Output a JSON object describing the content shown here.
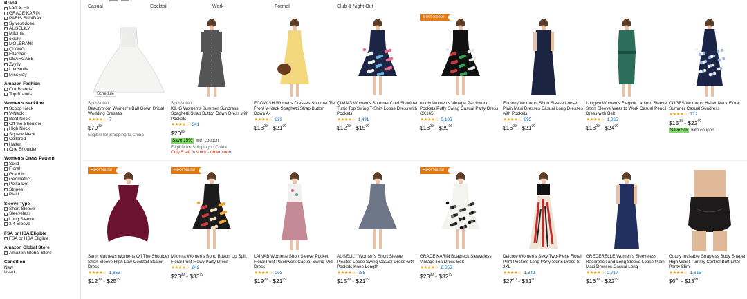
{
  "sidebar": {
    "brand": {
      "title": "Brand",
      "options": [
        "Lark & Ro",
        "GRACE KARIN",
        "PARIS SUNDAY",
        "Sylvestidoso",
        "AUSELILY",
        "Milumia",
        "oxiuly",
        "MOLERANI",
        "QIXING",
        "Ellacher",
        "DEARCASE",
        "Zyyfly",
        "Lotusmile",
        "MissMay"
      ]
    },
    "fashion": {
      "title": "Amazon Fashion",
      "options": [
        "Our Brands",
        "Top Brands"
      ]
    },
    "neckline": {
      "title": "Women's Neckline",
      "options": [
        "Scoop Neck",
        "V-Neck",
        "Boat Neck",
        "Off the Shoulder",
        "High Neck",
        "Square Neck",
        "Collared",
        "Halter",
        "One Shoulder"
      ]
    },
    "pattern": {
      "title": "Women's Dress Pattern",
      "options": [
        "Solid",
        "Floral",
        "Graphic",
        "Geometric",
        "Polka Dot",
        "Stripes",
        "Plaid"
      ]
    },
    "sleeve": {
      "title": "Sleeve Type",
      "options": [
        "Short Sleeve",
        "Sleeveless",
        "Long Sleeve",
        "3/4 Sleeve"
      ]
    },
    "fsa": {
      "title": "FSA or HSA Eligible",
      "options": [
        "FSA or HSA Eligible"
      ]
    },
    "global": {
      "title": "Amazon Global Store",
      "options": [
        "Amazon Global Store"
      ]
    },
    "condition": {
      "title": "Condition",
      "items": [
        "New",
        "Used"
      ]
    }
  },
  "tabs": [
    "Casual",
    "Cocktail",
    "Work",
    "Formal",
    "Club & Night Out"
  ],
  "products": [
    {
      "badge": "",
      "sponsored": "Sponsored",
      "title": "Beautyprom Women's Ball Gown Bridal Wedding Dresses",
      "stars": "★★★★☆",
      "count": "7",
      "price_html": "$79<sup>99</sup>",
      "coupon": "",
      "coupon_label": "",
      "ship": "Eligible for Shipping to China",
      "stock": "",
      "schedule": "Schedule",
      "img": "gown"
    },
    {
      "badge": "",
      "sponsored": "Sponsored",
      "title": "KILIG Women's Summer Sundress Spaghetti Strap Button Down Dress with Pockets",
      "stars": "★★★★☆",
      "count": "341",
      "price_html": "$20<sup>99</sup>",
      "coupon": "Save 15%",
      "coupon_label": "with coupon",
      "ship": "Eligible for Shipping to China",
      "stock": "Only 5 left in stock - order soon.",
      "schedule": "",
      "img": "grey"
    },
    {
      "badge": "",
      "sponsored": "",
      "title": "ECOWISH Womens Dresses Summer Tie Front V-Neck Spaghetti Strap Button Down A-",
      "stars": "★★★★☆",
      "count": "829",
      "price_html": "$18<sup>99</sup> - $21<sup>99</sup>",
      "coupon": "",
      "coupon_label": "",
      "ship": "",
      "stock": "",
      "schedule": "",
      "img": "yellow"
    },
    {
      "badge": "",
      "sponsored": "",
      "title": "QIXING Women's Summer Cold Shoulder Tunic Top Swing T-Shirt Loose Dress with Pockets",
      "stars": "★★★★☆",
      "count": "1,491",
      "price_html": "$12<sup>99</sup> - $15<sup>99</sup>",
      "coupon": "",
      "coupon_label": "",
      "ship": "",
      "stock": "",
      "schedule": "",
      "img": "floralnavy"
    },
    {
      "badge": "Best Seller",
      "sponsored": "",
      "title": "oxiuly Women's Vintage Patchwork Pockets Puffy Swing Casual Party Dress OX165",
      "stars": "★★★★☆",
      "count": "5,106",
      "price_html": "$18<sup>99</sup> - $29<sup>96</sup>",
      "coupon": "",
      "coupon_label": "",
      "ship": "",
      "stock": "",
      "schedule": "",
      "img": "patch"
    },
    {
      "badge": "",
      "sponsored": "",
      "title": "Euovmy Women's Short Sleeve Loose Plain Maxi Dresses Casual Long Dresses with Pockets",
      "stars": "★★★★☆",
      "count": "895",
      "price_html": "$16<sup>99</sup> - $21<sup>99</sup>",
      "coupon": "",
      "coupon_label": "",
      "ship": "",
      "stock": "",
      "schedule": "",
      "img": "navymaxi"
    },
    {
      "badge": "",
      "sponsored": "",
      "title": "Longwu Women's Elegant Lantern Sleeve Short Sleeve Wear to Work Casual Pencil Dress with Belt",
      "stars": "★★★★☆",
      "count": "1,035",
      "price_html": "$18<sup>99</sup> - $24<sup>99</sup>",
      "coupon": "",
      "coupon_label": "",
      "ship": "",
      "stock": "",
      "schedule": "",
      "img": "green"
    },
    {
      "badge": "",
      "sponsored": "",
      "title": "OUGES Women's Halter Neck Floral Summer Casual Sundress",
      "stars": "★★★★☆",
      "count": "772",
      "price_html": "$15<sup>99</sup> - $22<sup>99</sup>",
      "coupon": "Save 5%",
      "coupon_label": "with coupon",
      "ship": "",
      "stock": "",
      "schedule": "",
      "img": "halter"
    },
    {
      "badge": "Best Seller",
      "sponsored": "",
      "title": "Sarin Mathews Womens Off The Shoulder Short Sleeve High Low Cocktail Skater Dress",
      "stars": "★★★★☆",
      "count": "1,655",
      "price_html": "$12<sup>99</sup> - $25<sup>99</sup>",
      "coupon": "",
      "coupon_label": "",
      "ship": "",
      "stock": "",
      "schedule": "",
      "img": "burgundy"
    },
    {
      "badge": "Best Seller",
      "sponsored": "",
      "title": "Milumia Women's Boho Button Up Split Floral Print Flowy Party Dress",
      "stars": "★★★★☆",
      "count": "842",
      "price_html": "$23<sup>99</sup> - $33<sup>99</sup>",
      "coupon": "",
      "coupon_label": "",
      "ship": "",
      "stock": "",
      "schedule": "",
      "img": "boho"
    },
    {
      "badge": "",
      "sponsored": "",
      "title": "LAINAB Womens Short Sleeve Pocket Floral Print Patchwork Casual Swing Midi Dress",
      "stars": "★★★★☆",
      "count": "203",
      "price_html": "$19<sup>99</sup> - $21<sup>99</sup>",
      "coupon": "",
      "coupon_label": "",
      "ship": "",
      "stock": "",
      "schedule": "",
      "img": "mauve"
    },
    {
      "badge": "",
      "sponsored": "",
      "title": "AUSELILY Women's Short Sleeve Pleated Loose Swing Casual Dress with Pockets Knee Length",
      "stars": "★★★★☆",
      "count": "785",
      "price_html": "$15<sup>99</sup> - $21<sup>99</sup>",
      "coupon": "",
      "coupon_label": "",
      "ship": "",
      "stock": "",
      "schedule": "",
      "img": "slate"
    },
    {
      "badge": "Best Seller",
      "sponsored": "",
      "title": "GRACE KARIN Boatneck Sleeveless Vintage Tea Dress Belt",
      "stars": "★★★★☆",
      "count": "8,655",
      "price_html": "$23<sup>99</sup> - $32<sup>99</sup>",
      "coupon": "",
      "coupon_label": "",
      "ship": "",
      "stock": "",
      "schedule": "",
      "img": "whitefloral"
    },
    {
      "badge": "",
      "sponsored": "",
      "title": "Delcore Women's Sexy Two-Piece Floral Print Pockets Long Party Skirts Dress S-2XL",
      "stars": "★★★★☆",
      "count": "1,342",
      "price_html": "$27<sup>10</sup> - $31<sup>90</sup>",
      "coupon": "",
      "coupon_label": "",
      "ship": "",
      "stock": "",
      "schedule": "",
      "img": "twopiece"
    },
    {
      "badge": "",
      "sponsored": "",
      "title": "GRECERELLE Women's Sleeveless Racerback and Long Sleeve Loose Plain Maxi Dresses Casual Long",
      "stars": "★★★★☆",
      "count": "2,717",
      "price_html": "$16<sup>99</sup> - $22<sup>99</sup>",
      "coupon": "",
      "coupon_label": "",
      "ship": "",
      "stock": "",
      "schedule": "",
      "img": "navylong"
    },
    {
      "badge": "",
      "sponsored": "",
      "title": "Gotoly Invisable Strapless Body Shaper High Waist Tummy Control Butt Lifter Panty Slim",
      "stars": "★★★★☆",
      "count": "1,615",
      "price_html": "$6<sup>80</sup> - $13<sup>99</sup>",
      "coupon": "",
      "coupon_label": "",
      "ship": "",
      "stock": "",
      "schedule": "",
      "img": "shaper"
    }
  ]
}
